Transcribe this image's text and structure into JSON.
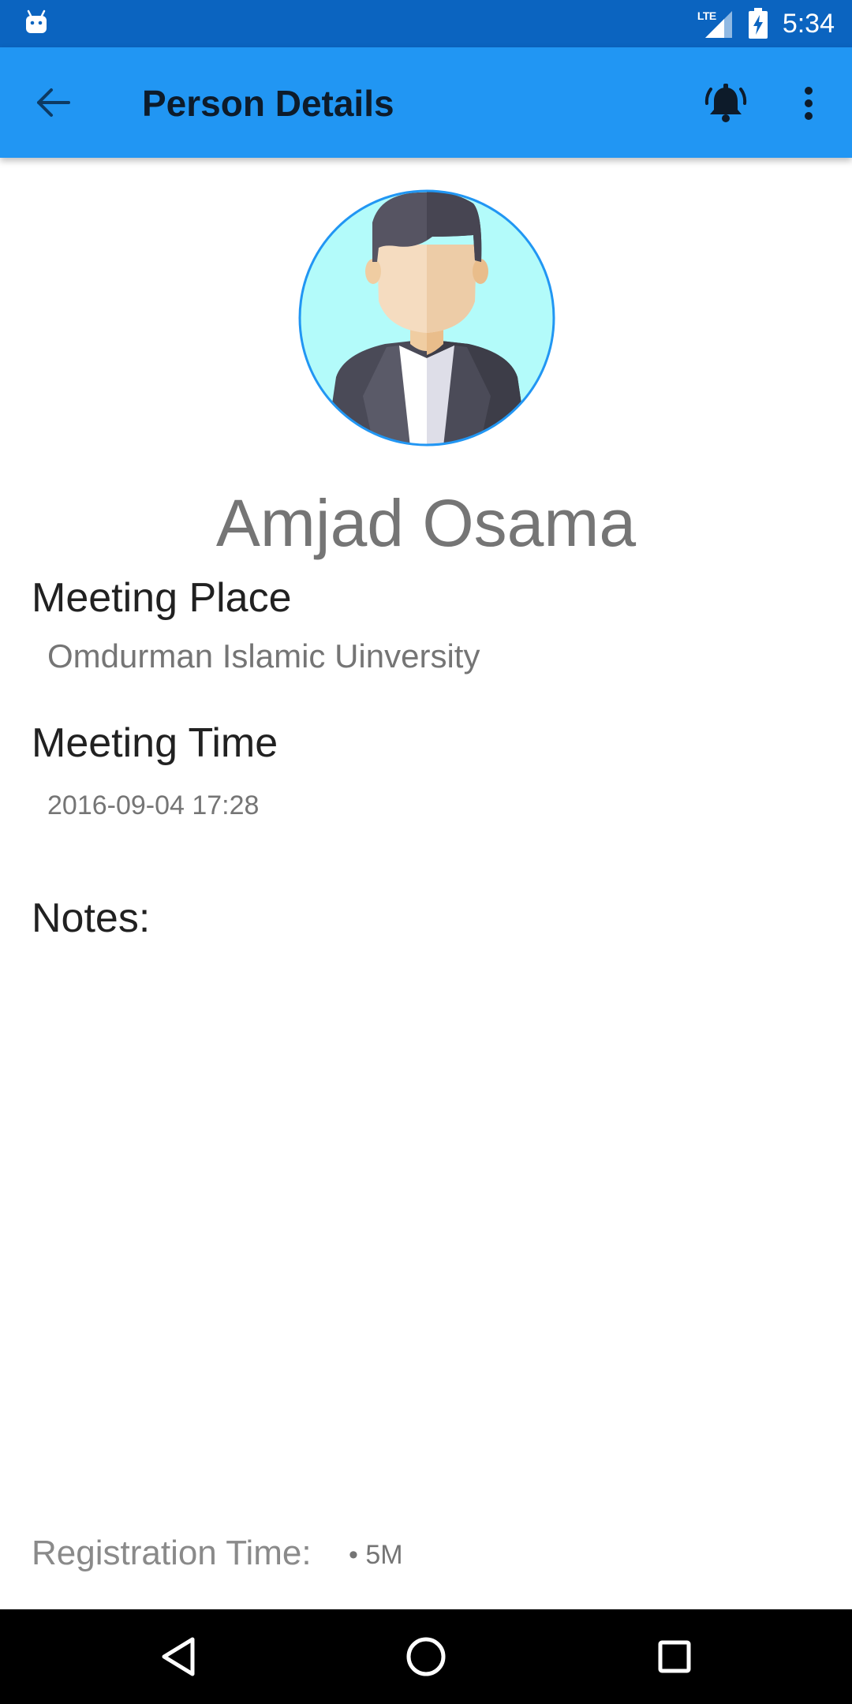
{
  "status_bar": {
    "time": "5:34",
    "network_label": "LTE",
    "left_icon": "android-debug-icon",
    "signal_icon": "signal-icon",
    "battery_icon": "battery-charging-icon"
  },
  "app_bar": {
    "title": "Person Details",
    "back_icon": "arrow-back-icon",
    "alarm_icon": "alarm-bell-icon",
    "more_icon": "more-vertical-icon",
    "color": "#2196f3",
    "status_color": "#0b64c0"
  },
  "person": {
    "avatar_icon": "person-avatar-icon",
    "name": "Amjad Osama"
  },
  "meeting_place": {
    "label": "Meeting Place",
    "value": "Omdurman Islamic Uinversity"
  },
  "meeting_time": {
    "label": "Meeting Time",
    "value": "2016-09-04 17:28"
  },
  "notes": {
    "label": "Notes:"
  },
  "registration": {
    "label": "Registration Time:",
    "value": "• 5M"
  },
  "nav_bar": {
    "back_icon": "nav-back-icon",
    "home_icon": "nav-home-icon",
    "recents_icon": "nav-recents-icon"
  }
}
